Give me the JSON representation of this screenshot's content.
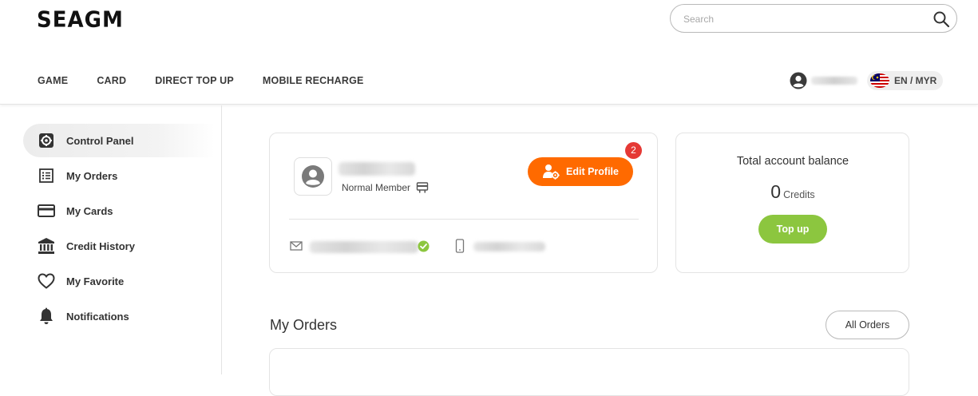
{
  "header": {
    "logo_text": "SEAGM",
    "search": {
      "placeholder": "Search",
      "value": ""
    },
    "nav": [
      "GAME",
      "CARD",
      "DIRECT TOP UP",
      "MOBILE RECHARGE"
    ],
    "language_label": "EN / MYR"
  },
  "sidebar": {
    "items": [
      {
        "label": "Control Panel",
        "icon": "gear-icon",
        "active": true
      },
      {
        "label": "My Orders",
        "icon": "list-icon",
        "active": false
      },
      {
        "label": "My Cards",
        "icon": "credit-card-icon",
        "active": false
      },
      {
        "label": "Credit History",
        "icon": "bank-icon",
        "active": false
      },
      {
        "label": "My Favorite",
        "icon": "heart-icon",
        "active": false
      },
      {
        "label": "Notifications",
        "icon": "bell-icon",
        "active": false
      }
    ]
  },
  "profile": {
    "member_level": "Normal Member",
    "edit_label": "Edit Profile",
    "notification_count": "2"
  },
  "balance": {
    "title": "Total account balance",
    "amount": "0",
    "unit": "Credits",
    "topup_label": "Top up"
  },
  "orders": {
    "title": "My Orders",
    "all_label": "All Orders"
  },
  "colors": {
    "accent_orange": "#ff6a00",
    "accent_green": "#8cc63f",
    "badge_red": "#e53935"
  }
}
